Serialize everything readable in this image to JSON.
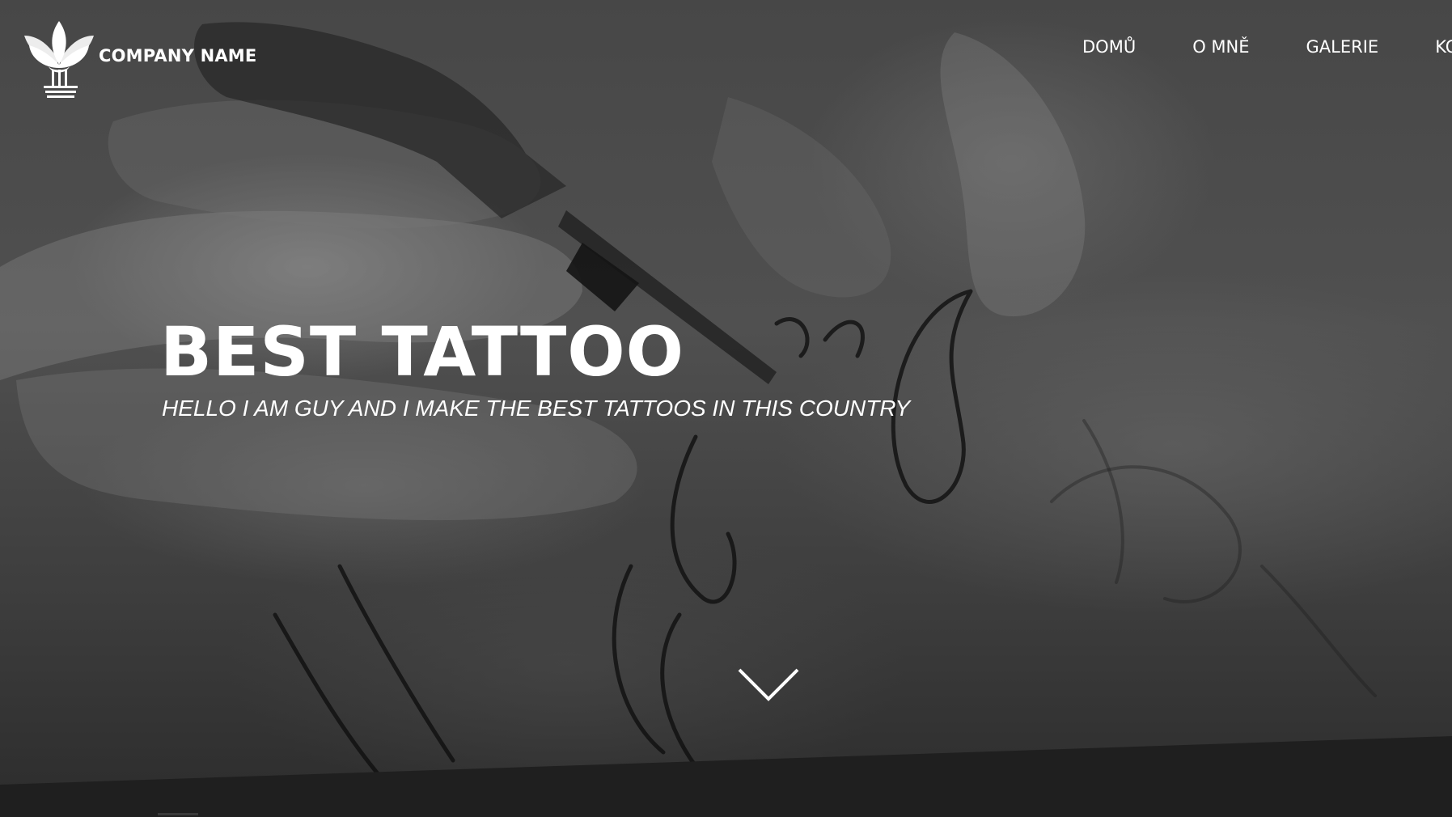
{
  "brand": {
    "name": "COMPANY NAME",
    "logo_icon": "lotus-logo-icon"
  },
  "nav": {
    "items": [
      {
        "label": "DOMŮ"
      },
      {
        "label": "O MNĚ"
      },
      {
        "label": "GALERIE"
      },
      {
        "label": "KO"
      }
    ]
  },
  "hero": {
    "title": "BEST TATTOO",
    "subtitle": "HELLO I AM GUY AND I MAKE THE BEST TATTOOS IN THIS COUNTRY",
    "scroll_icon": "chevron-down-icon"
  },
  "colors": {
    "text": "#ffffff",
    "overlay": "#4a4a4a",
    "footer_band": "#1f1f1f"
  }
}
